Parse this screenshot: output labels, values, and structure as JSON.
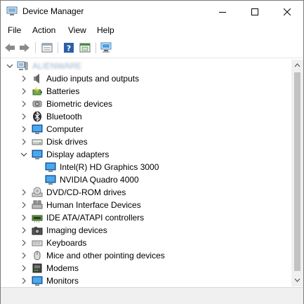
{
  "window": {
    "title": "Device Manager"
  },
  "menu": [
    "File",
    "Action",
    "View",
    "Help"
  ],
  "toolbar": {
    "buttons": [
      "back-arrow-icon",
      "forward-arrow-icon",
      "properties-icon",
      "help-icon",
      "update-driver-icon",
      "scan-hardware-icon"
    ]
  },
  "tree": {
    "root": {
      "label": "ALIENWARE",
      "icon": "computer-root-icon"
    },
    "items": [
      {
        "label": "Audio inputs and outputs",
        "icon": "speaker-icon",
        "expanded": false
      },
      {
        "label": "Batteries",
        "icon": "battery-icon",
        "expanded": false
      },
      {
        "label": "Biometric devices",
        "icon": "biometric-icon",
        "expanded": false
      },
      {
        "label": "Bluetooth",
        "icon": "bluetooth-icon",
        "expanded": false
      },
      {
        "label": "Computer",
        "icon": "computer-icon",
        "expanded": false
      },
      {
        "label": "Disk drives",
        "icon": "disk-icon",
        "expanded": false
      },
      {
        "label": "Display adapters",
        "icon": "monitor-icon",
        "expanded": true,
        "children": [
          {
            "label": "Intel(R) HD Graphics 3000",
            "icon": "monitor-icon"
          },
          {
            "label": "NVIDIA Quadro 4000",
            "icon": "monitor-icon"
          }
        ]
      },
      {
        "label": "DVD/CD-ROM drives",
        "icon": "dvd-icon",
        "expanded": false
      },
      {
        "label": "Human Interface Devices",
        "icon": "hid-icon",
        "expanded": false
      },
      {
        "label": "IDE ATA/ATAPI controllers",
        "icon": "ide-controller-icon",
        "expanded": false
      },
      {
        "label": "Imaging devices",
        "icon": "camera-icon",
        "expanded": false
      },
      {
        "label": "Keyboards",
        "icon": "keyboard-icon",
        "expanded": false
      },
      {
        "label": "Mice and other pointing devices",
        "icon": "mouse-icon",
        "expanded": false
      },
      {
        "label": "Modems",
        "icon": "modem-icon",
        "expanded": false
      },
      {
        "label": "Monitors",
        "icon": "monitor-icon",
        "expanded": false
      }
    ]
  },
  "colors": {
    "accent": "#1e73be",
    "window_border": "#7a7a7a",
    "status_bg": "#f0f0f0"
  }
}
